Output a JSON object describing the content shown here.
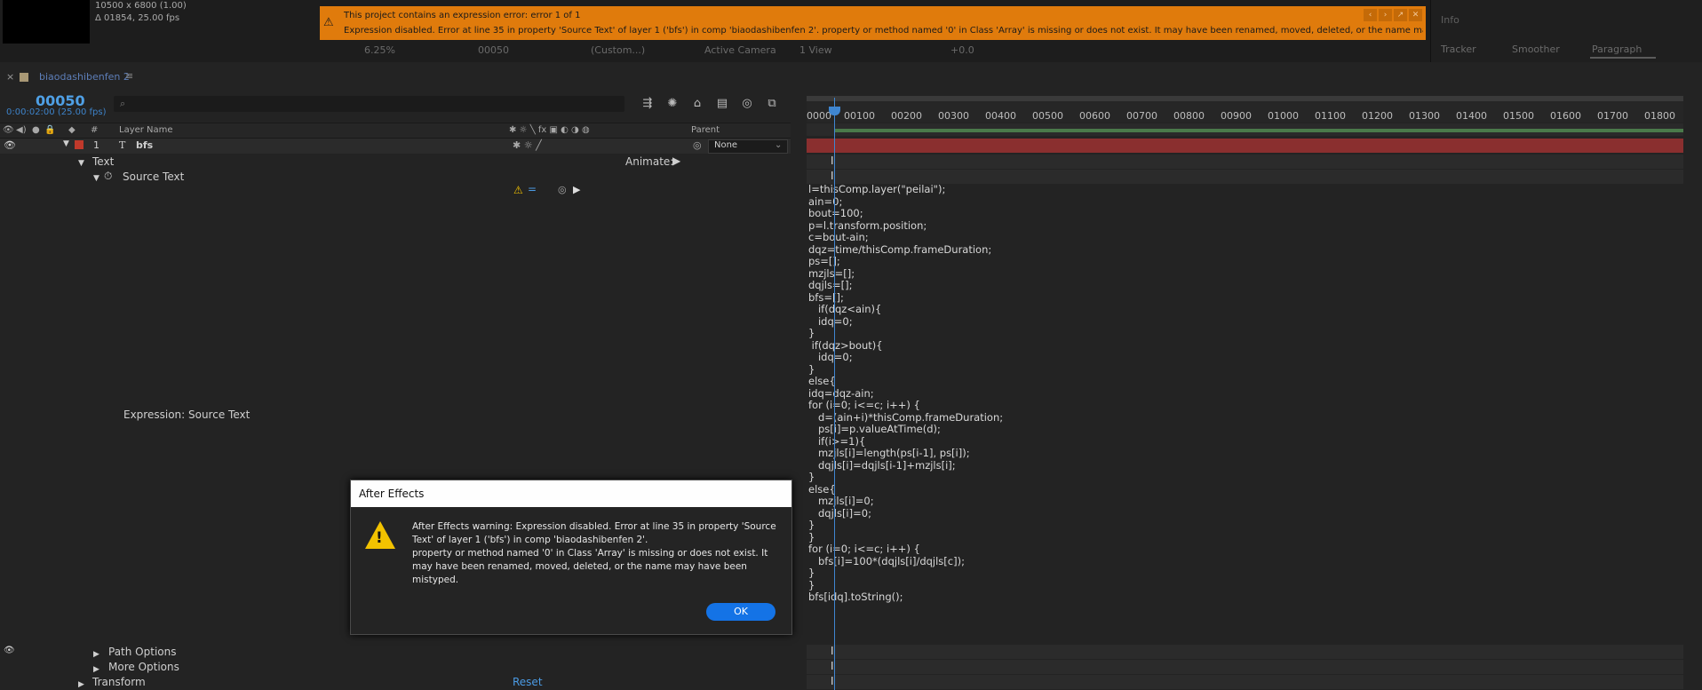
{
  "comp_info": {
    "resolution": "10500 x 6800 (1.00)",
    "delta": "Δ 01854, 25.00 fps"
  },
  "error_banner": {
    "line1": "This project contains an expression error: error 1 of 1",
    "line2": "Expression disabled. Error at line 35 in property 'Source Text' of layer 1 ('bfs') in comp 'biaodashibenfen 2'. property or method named '0' in Class 'Array' is missing or does not exist. It may have been renamed, moved, deleted, or the name may have been mistyped.. property",
    "color": "#e07b0c"
  },
  "viewer_bar": {
    "zoom": "6.25%",
    "frame": "00050",
    "resolution": "(Custom...)",
    "camera": "Active Camera",
    "views": "1 View",
    "exposure": "+0.0"
  },
  "right_panel": {
    "info": "Info",
    "tabs": [
      "Tracker",
      "Smoother",
      "Paragraph"
    ]
  },
  "comp_tab": {
    "name": "biaodashibenfen 2",
    "swatch_color": "#a89875"
  },
  "timeline": {
    "timecode": "00050",
    "subtime": "0:00:02:00 (25.00 fps)",
    "search_placeholder": "",
    "columns": {
      "num": "#",
      "layer_name": "Layer Name",
      "parent": "Parent"
    },
    "ruler": [
      "0000",
      "00100",
      "00200",
      "00300",
      "00400",
      "00500",
      "00600",
      "00700",
      "00800",
      "00900",
      "01000",
      "01100",
      "01200",
      "01300",
      "01400",
      "01500",
      "01600",
      "01700",
      "01800"
    ]
  },
  "layer": {
    "index": "1",
    "type": "T",
    "name": "bfs",
    "parent": "None",
    "label_color": "#c0392b"
  },
  "properties": {
    "text": "Text",
    "animate": "Animate:",
    "source_text": "Source Text",
    "expression_label": "Expression: Source Text",
    "path_options": "Path Options",
    "more_options": "More Options",
    "transform": "Transform",
    "reset": "Reset"
  },
  "expression_code": "l=thisComp.layer(\"peilai\");\nain=0;\nbout=100;\np=l.transform.position;\nc=bout-ain;\ndqz=time/thisComp.frameDuration;\nps=[];\nmzjls=[];\ndqjls=[];\nbfs=[];\n   if(dqz<ain){\n   idq=0;\n}\n if(dqz>bout){\n   idq=0;\n}\nelse{\nidq=dqz-ain;\nfor (i=0; i<=c; i++) {\n   d=(ain+i)*thisComp.frameDuration;\n   ps[i]=p.valueAtTime(d);\n   if(i>=1){\n   mzjls[i]=length(ps[i-1], ps[i]);\n   dqjls[i]=dqjls[i-1]+mzjls[i];\n}\nelse{\n   mzjls[i]=0;\n   dqjls[i]=0;\n}\n}\nfor (i=0; i<=c; i++) {\n   bfs[i]=100*(dqjls[i]/dqjls[c]);\n}\n}\nbfs[idq].toString();",
  "dialog": {
    "title": "After Effects",
    "message": "After Effects warning: Expression disabled. Error at line 35 in property 'Source Text' of layer 1 ('bfs') in comp 'biaodashibenfen 2'.\nproperty or method named '0' in Class 'Array' is missing or does not exist. It may have been renamed, moved, deleted, or the name may have been mistyped.",
    "ok": "OK"
  }
}
